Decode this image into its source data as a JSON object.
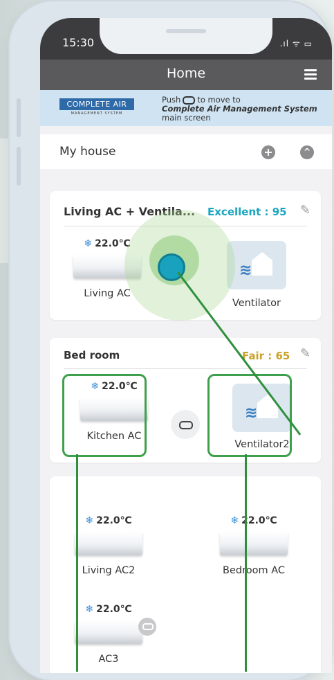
{
  "status": {
    "time": "15:30",
    "signal": ".ıl ᯤ ▭"
  },
  "header": {
    "title": "Home"
  },
  "banner": {
    "logo_main": "COMPLETE AIR",
    "logo_sub": "MANAGEMENT SYSTEM",
    "line1_prefix": "Push",
    "line1_suffix": "to move to",
    "line2": "Complete Air Management System",
    "line3": "main screen"
  },
  "house": {
    "label": "My house",
    "add": "+",
    "collapse": "^"
  },
  "groups": [
    {
      "title": "Living AC + Ventila...",
      "score": "Excellent : 95",
      "score_color": "#1aa6c0",
      "devices": [
        {
          "name": "Living AC",
          "temp": "22.0℃",
          "type": "ac"
        },
        {
          "name": "Ventilator",
          "type": "ventilator"
        }
      ]
    },
    {
      "title": "Bed room",
      "score": "Fair : 65",
      "score_color": "#c9a227",
      "devices": [
        {
          "name": "Kitchen AC",
          "temp": "22.0℃",
          "type": "ac"
        },
        {
          "name": "Ventilator2",
          "type": "ventilator"
        }
      ]
    }
  ],
  "ungrouped": [
    {
      "name": "Living AC2",
      "temp": "22.0℃"
    },
    {
      "name": "Bedroom AC",
      "temp": "22.0℃"
    },
    {
      "name": "AC3",
      "temp": "22.0℃"
    }
  ],
  "icons": {
    "snow": "❄",
    "pencil": "✎"
  }
}
